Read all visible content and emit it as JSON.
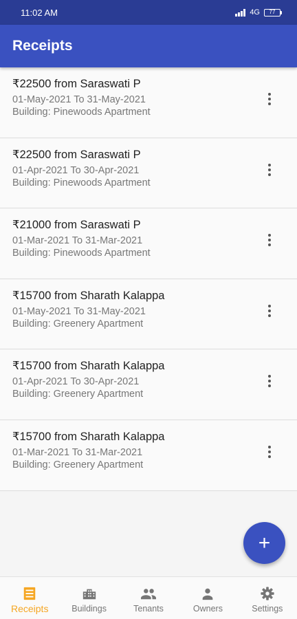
{
  "status_bar": {
    "time": "11:02 AM",
    "network": "4G",
    "battery": "77"
  },
  "app_bar": {
    "title": "Receipts"
  },
  "receipts": [
    {
      "title": "₹22500 from Saraswati P",
      "period": "01-May-2021 To 31-May-2021",
      "building": "Building: Pinewoods Apartment"
    },
    {
      "title": "₹22500 from Saraswati P",
      "period": "01-Apr-2021 To 30-Apr-2021",
      "building": "Building: Pinewoods Apartment"
    },
    {
      "title": "₹21000 from Saraswati P",
      "period": "01-Mar-2021 To 31-Mar-2021",
      "building": "Building: Pinewoods Apartment"
    },
    {
      "title": "₹15700 from Sharath Kalappa",
      "period": "01-May-2021 To 31-May-2021",
      "building": "Building: Greenery Apartment"
    },
    {
      "title": "₹15700 from Sharath Kalappa",
      "period": "01-Apr-2021 To 30-Apr-2021",
      "building": "Building: Greenery Apartment"
    },
    {
      "title": "₹15700 from Sharath Kalappa",
      "period": "01-Mar-2021 To 31-Mar-2021",
      "building": "Building: Greenery Apartment"
    }
  ],
  "fab": {
    "icon": "plus-icon",
    "label": "+"
  },
  "bottom_nav": {
    "items": [
      {
        "label": "Receipts",
        "icon": "receipt-icon",
        "active": true
      },
      {
        "label": "Buildings",
        "icon": "building-icon",
        "active": false
      },
      {
        "label": "Tenants",
        "icon": "people-icon",
        "active": false
      },
      {
        "label": "Owners",
        "icon": "person-icon",
        "active": false
      },
      {
        "label": "Settings",
        "icon": "gear-icon",
        "active": false
      }
    ]
  },
  "colors": {
    "primary": "#3a51c0",
    "status_bar": "#2a3c94",
    "accent_active": "#f5a623",
    "inactive": "#757575"
  }
}
